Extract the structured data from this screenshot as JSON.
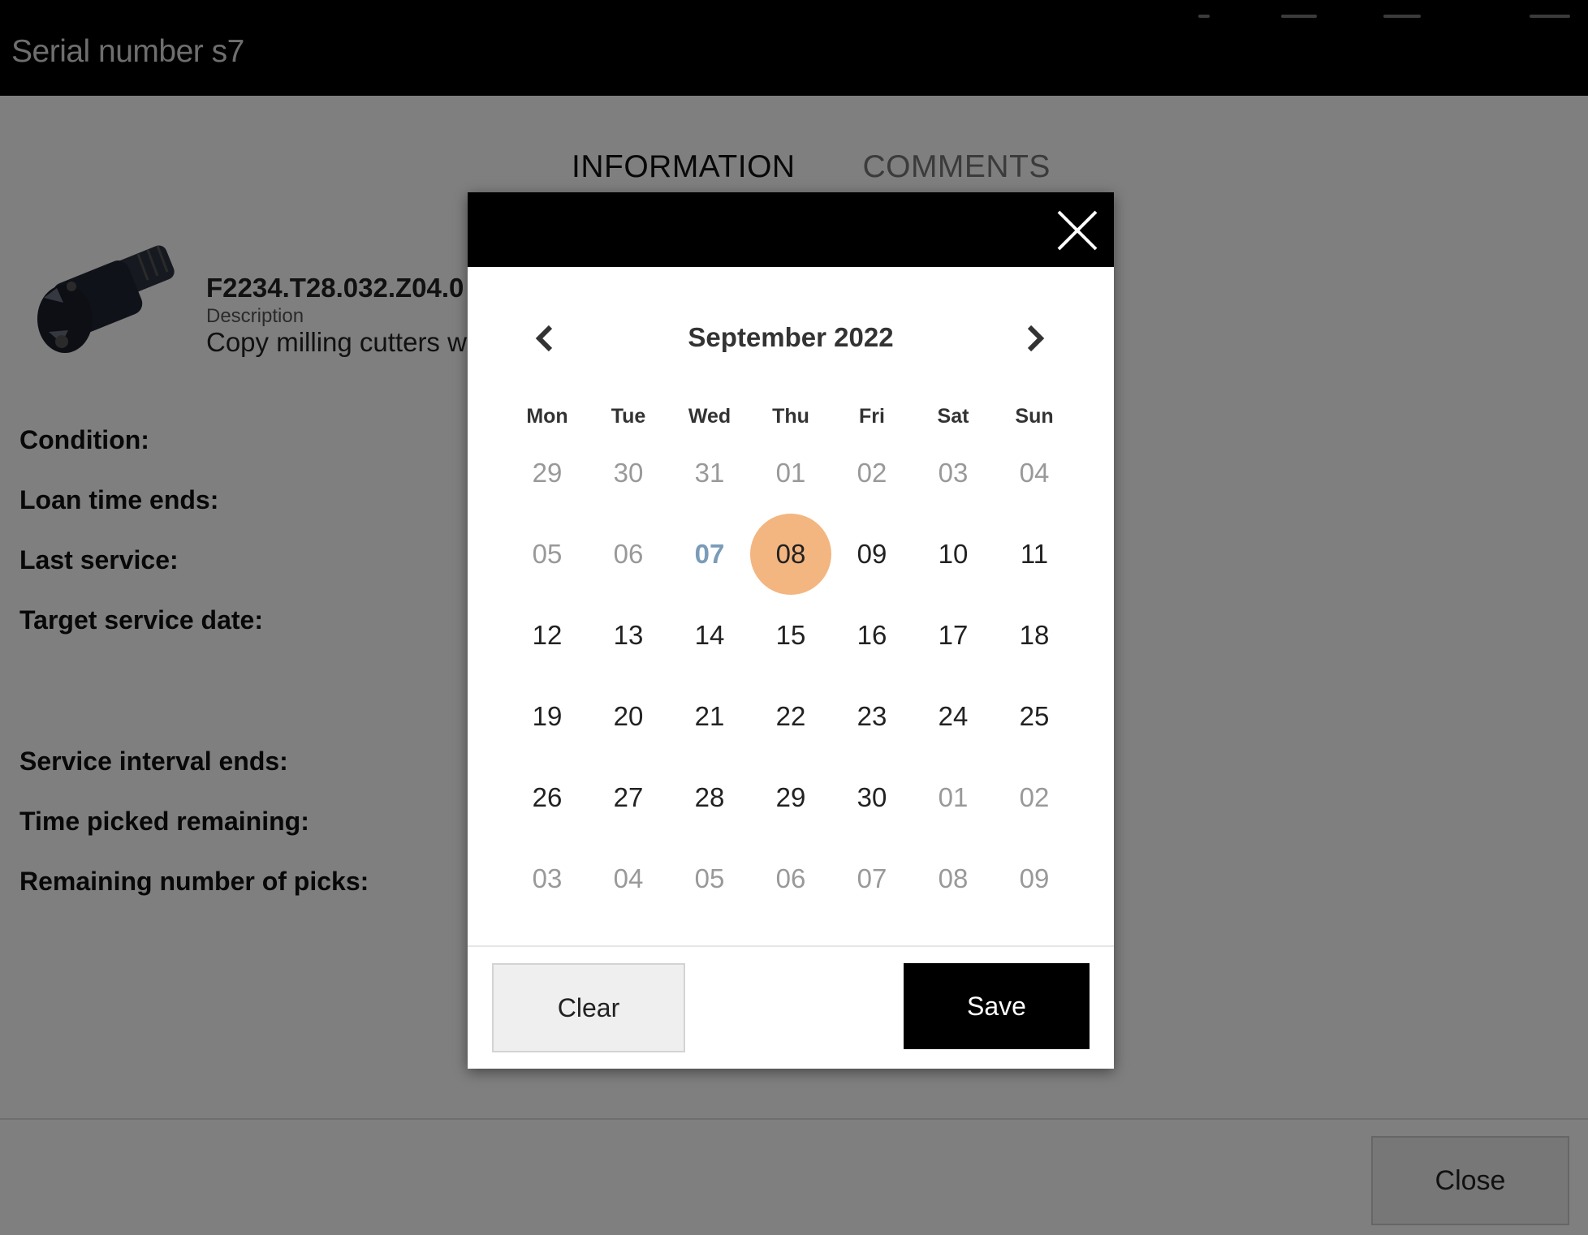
{
  "header": {
    "title": "Serial number s7"
  },
  "tabs": [
    {
      "label": "INFORMATION",
      "active": true
    },
    {
      "label": "COMMENTS",
      "active": false
    }
  ],
  "product": {
    "code": "F2234.T28.032.Z04.0",
    "description_label": "Description",
    "description": "Copy milling cutters wit"
  },
  "fields": [
    {
      "label": "Condition:"
    },
    {
      "label": "Loan time ends:"
    },
    {
      "label": "Last service:"
    },
    {
      "label": "Target service date:"
    },
    {
      "label": "Service interval ends:"
    },
    {
      "label": "Time picked remaining:"
    },
    {
      "label": "Remaining number of picks:"
    }
  ],
  "footer": {
    "close_label": "Close"
  },
  "calendar": {
    "title": "September 2022",
    "weekdays": [
      "Mon",
      "Tue",
      "Wed",
      "Thu",
      "Fri",
      "Sat",
      "Sun"
    ],
    "today": "07",
    "selected": "08",
    "selected_color": "#f3b680",
    "today_color": "#7a9cb8",
    "weeks": [
      [
        {
          "d": "29",
          "m": true
        },
        {
          "d": "30",
          "m": true
        },
        {
          "d": "31",
          "m": true
        },
        {
          "d": "01",
          "m": true
        },
        {
          "d": "02",
          "m": true
        },
        {
          "d": "03",
          "m": true
        },
        {
          "d": "04",
          "m": true
        }
      ],
      [
        {
          "d": "05",
          "m": true
        },
        {
          "d": "06",
          "m": true
        },
        {
          "d": "07",
          "t": true
        },
        {
          "d": "08",
          "s": true
        },
        {
          "d": "09"
        },
        {
          "d": "10"
        },
        {
          "d": "11"
        }
      ],
      [
        {
          "d": "12"
        },
        {
          "d": "13"
        },
        {
          "d": "14"
        },
        {
          "d": "15"
        },
        {
          "d": "16"
        },
        {
          "d": "17"
        },
        {
          "d": "18"
        }
      ],
      [
        {
          "d": "19"
        },
        {
          "d": "20"
        },
        {
          "d": "21"
        },
        {
          "d": "22"
        },
        {
          "d": "23"
        },
        {
          "d": "24"
        },
        {
          "d": "25"
        }
      ],
      [
        {
          "d": "26"
        },
        {
          "d": "27"
        },
        {
          "d": "28"
        },
        {
          "d": "29"
        },
        {
          "d": "30"
        },
        {
          "d": "01",
          "m": true
        },
        {
          "d": "02",
          "m": true
        }
      ],
      [
        {
          "d": "03",
          "m": true
        },
        {
          "d": "04",
          "m": true
        },
        {
          "d": "05",
          "m": true
        },
        {
          "d": "06",
          "m": true
        },
        {
          "d": "07",
          "m": true
        },
        {
          "d": "08",
          "m": true
        },
        {
          "d": "09",
          "m": true
        }
      ]
    ],
    "clear_label": "Clear",
    "save_label": "Save",
    "prev_icon": "chevron-left-icon",
    "next_icon": "chevron-right-icon",
    "close_icon": "close-icon"
  }
}
